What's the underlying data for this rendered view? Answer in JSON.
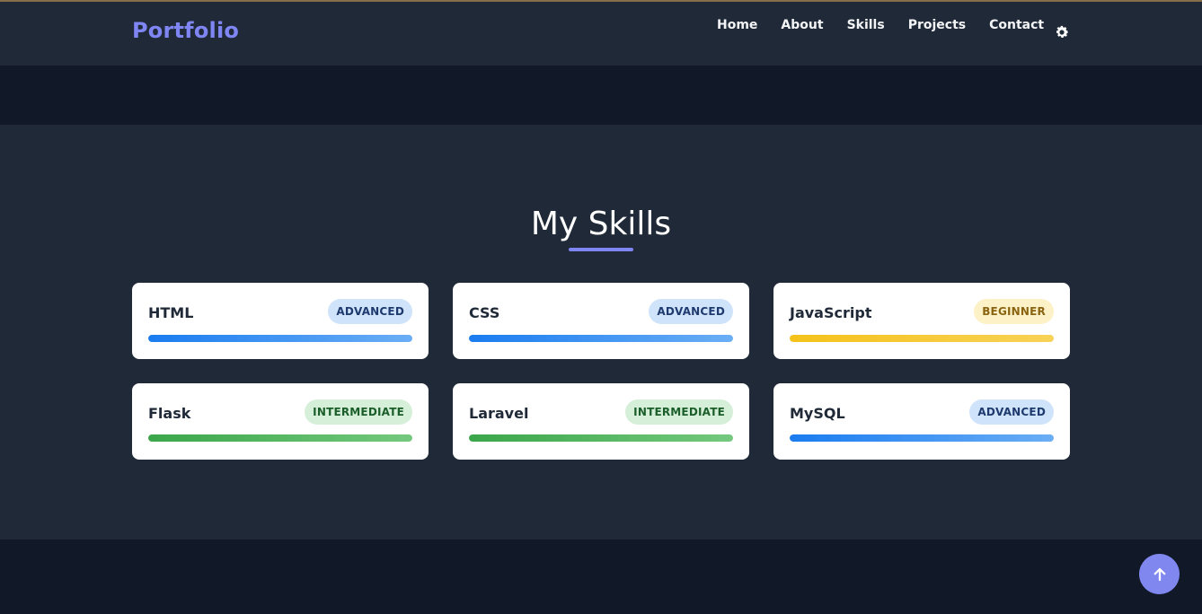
{
  "header": {
    "brand": "Portfolio",
    "nav": [
      "Home",
      "About",
      "Skills",
      "Projects",
      "Contact"
    ],
    "theme_icon": "gear-icon"
  },
  "skills_section": {
    "title": "My Skills",
    "skills": [
      {
        "name": "HTML",
        "level": "ADVANCED"
      },
      {
        "name": "CSS",
        "level": "ADVANCED"
      },
      {
        "name": "JavaScript",
        "level": "BEGINNER"
      },
      {
        "name": "Flask",
        "level": "INTERMEDIATE"
      },
      {
        "name": "Laravel",
        "level": "INTERMEDIATE"
      },
      {
        "name": "MySQL",
        "level": "ADVANCED"
      }
    ]
  },
  "scroll_top_icon": "arrow-up-icon",
  "colors": {
    "accent": "#7f86f3",
    "advanced": "#1a7cf0",
    "beginner": "#f5c21a",
    "intermediate": "#3aa649"
  }
}
